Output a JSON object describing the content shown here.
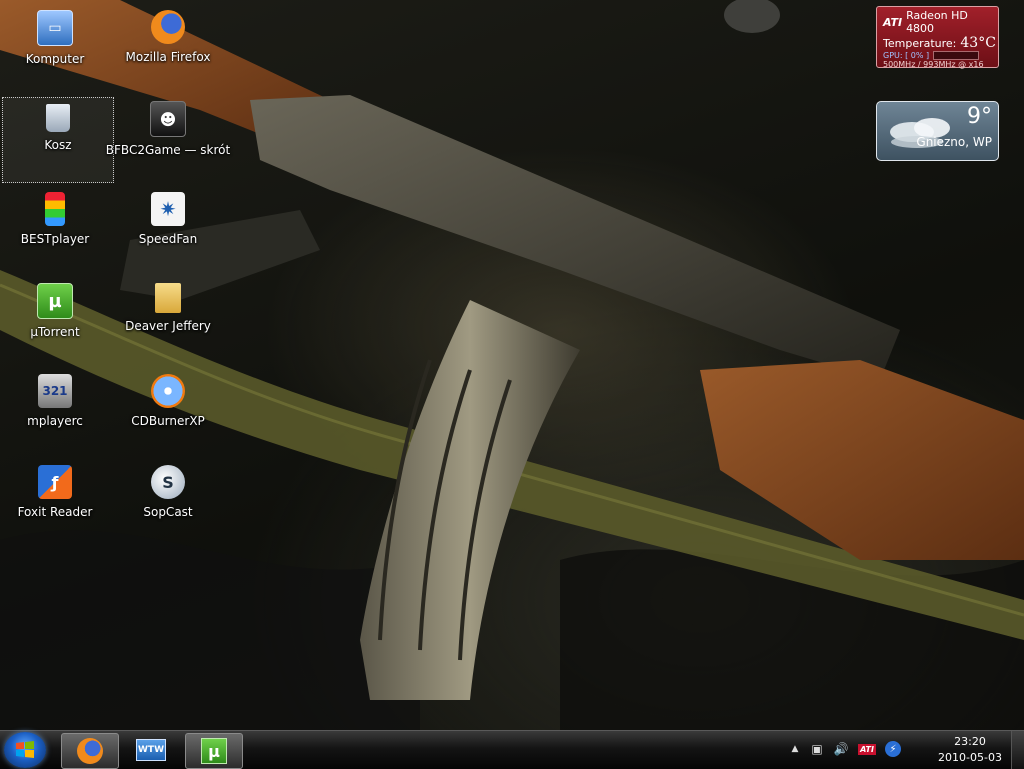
{
  "desktop": {
    "icons": [
      {
        "label": "Komputer",
        "icon": "computer-icon"
      },
      {
        "label": "Mozilla Firefox",
        "icon": "firefox-icon"
      },
      {
        "label": "Kosz",
        "icon": "recycle-bin-icon"
      },
      {
        "label": "BFBC2Game — skrót",
        "icon": "bfbc2-game-icon"
      },
      {
        "label": "BESTplayer",
        "icon": "bestplayer-icon"
      },
      {
        "label": "SpeedFan",
        "icon": "speedfan-icon"
      },
      {
        "label": "µTorrent",
        "icon": "utorrent-icon"
      },
      {
        "label": "Deaver Jeffery",
        "icon": "folder-icon"
      },
      {
        "label": "mplayerc",
        "icon": "mplayerc-icon"
      },
      {
        "label": "CDBurnerXP",
        "icon": "cdburnerxp-icon"
      },
      {
        "label": "Foxit Reader",
        "icon": "foxit-reader-icon"
      },
      {
        "label": "SopCast",
        "icon": "sopcast-icon"
      }
    ]
  },
  "ati_gadget": {
    "logo": "ATI",
    "title": "Radeon HD 4800",
    "temperature_label": "Temperature:",
    "temperature_value": "43°C",
    "gpu_label": "GPU: [ 0% ]",
    "gpu_load": 0.0,
    "clock_info": "500MHz / 993MHz @ x16",
    "color": "#8e1820"
  },
  "weather_gadget": {
    "temperature": "9°",
    "location": "Gniezno, WP"
  },
  "taskbar": {
    "start_icon": "windows-start-icon",
    "pinned": [
      {
        "icon": "firefox-icon",
        "active": true
      },
      {
        "icon": "wtw-icon",
        "label": "WTW",
        "active": false
      },
      {
        "icon": "utorrent-icon",
        "active": true
      }
    ],
    "tray": [
      {
        "icon": "show-hidden-icons-icon",
        "glyph": "▲"
      },
      {
        "icon": "network-icon",
        "glyph": "▣"
      },
      {
        "icon": "volume-icon",
        "glyph": "🔊"
      },
      {
        "icon": "ati-catalyst-icon",
        "glyph": "ATI"
      },
      {
        "icon": "update-icon",
        "glyph": "⚡"
      }
    ],
    "clock_time": "23:20",
    "clock_date": "2010-05-03"
  },
  "colors": {
    "accent": "#1b5fc4",
    "ati_red": "#8e1820",
    "utorrent_green": "#4aa72a"
  }
}
